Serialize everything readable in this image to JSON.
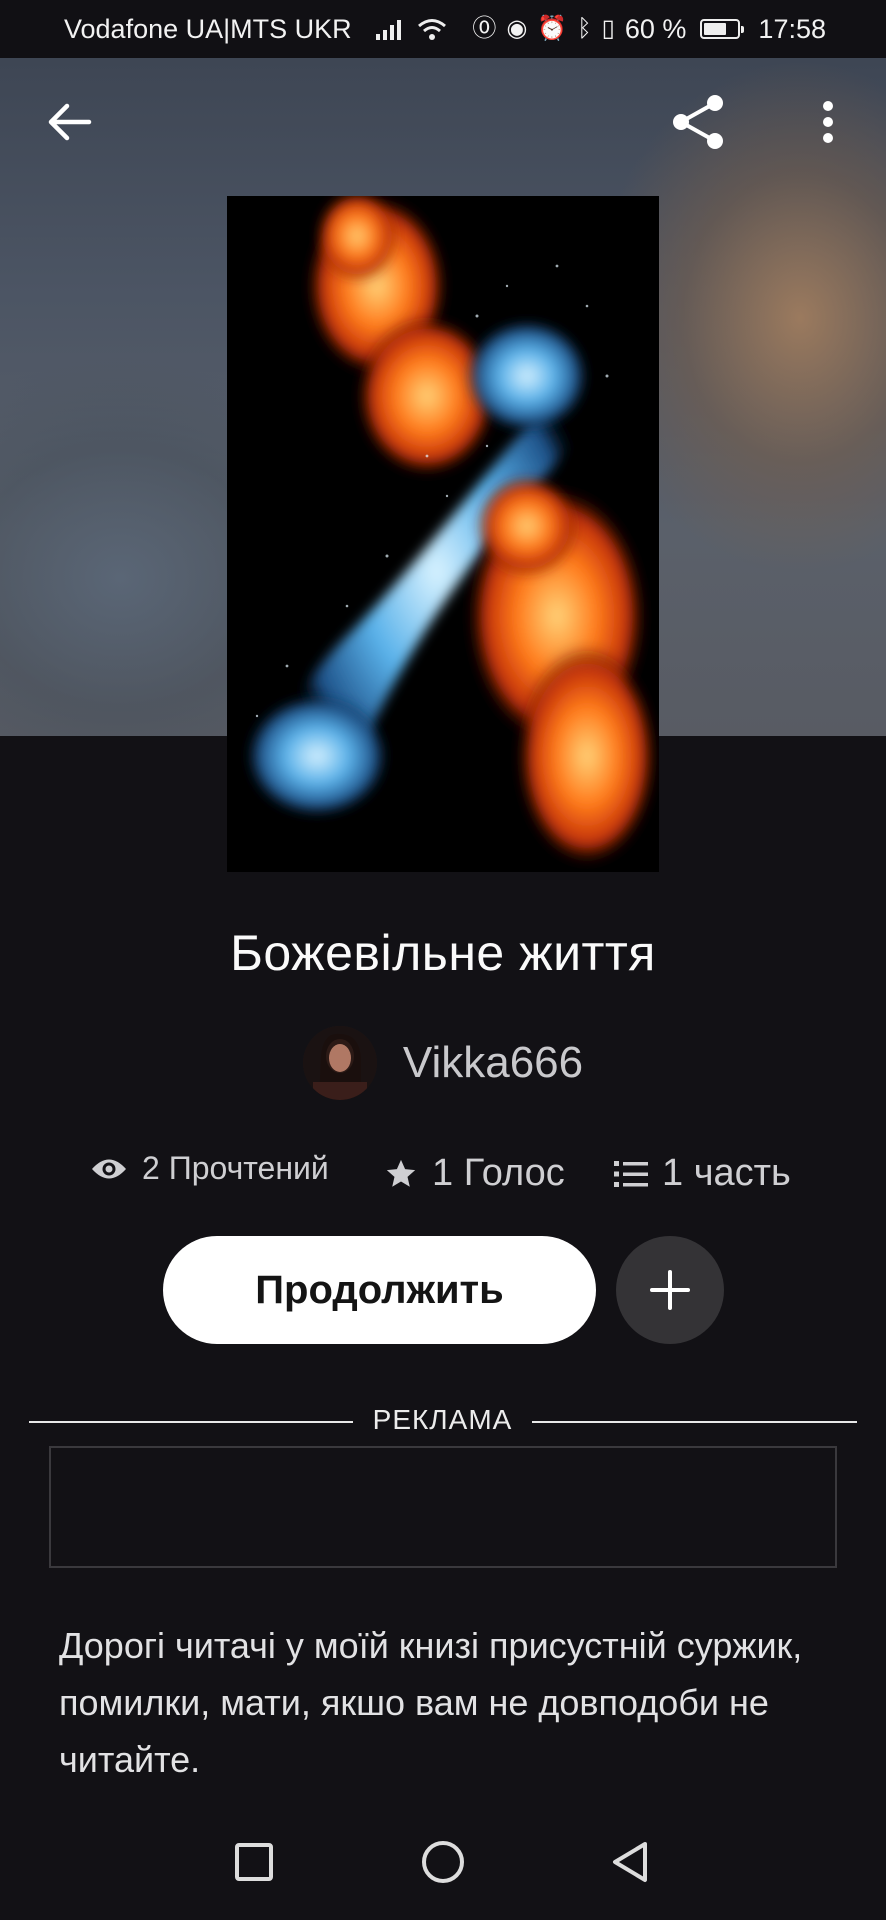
{
  "status_bar": {
    "carrier": "Vodafone UA|MTS UKR",
    "battery": "60 %",
    "time": "17:58"
  },
  "story": {
    "title": "Божевільне життя",
    "author": "Vikka666",
    "reads": "2 Прочтений",
    "votes": "1 Голос",
    "parts": "1 часть",
    "continue_label": "Продолжить",
    "description": "Дорогі читачі у моїй книзі присустній суржик, помилки, мати, якшо вам не довподоби не читайте."
  },
  "ad": {
    "label": "РЕКЛАМА"
  },
  "colors": {
    "background": "#121115",
    "primary_button": "#ffffff",
    "secondary_button": "#343336",
    "text_muted": "#c9c9cc"
  },
  "icons": {
    "back": "arrow-left-icon",
    "share": "share-icon",
    "more": "more-vertical-icon",
    "reads": "eye-icon",
    "votes": "star-icon",
    "parts": "list-icon",
    "add": "plus-icon"
  }
}
